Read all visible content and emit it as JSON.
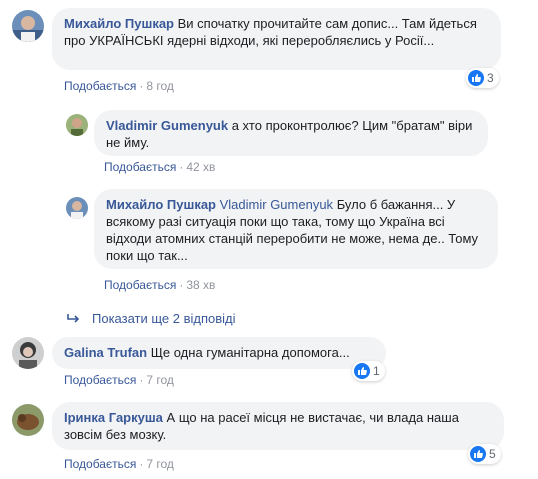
{
  "comments": [
    {
      "author": "Михайло Пушкар",
      "text": "Ви спочатку прочитайте сам допис... Там йдеться про УКРАЇНСЬКІ ядерні відходи, які переробляєлись у Росії...",
      "like_label": "Подобається",
      "time": "8 год",
      "reaction_count": "3"
    },
    {
      "author": "Vladimir Gumenyuk",
      "text": "а хто проконтролює? Цим \"братам\" віри не йму.",
      "like_label": "Подобається",
      "time": "42 хв"
    },
    {
      "author": "Михайло Пушкар",
      "mention": "Vladimir Gumenyuk",
      "text": "Було б бажання... У всякому разі ситуація поки що така, тому що Україна всі відходи атомних станцій переробити не може, нема де.. Тому поки що так...",
      "like_label": "Подобається",
      "time": "38 хв"
    },
    {
      "author": "Galina Trufan",
      "text": "Ще одна гуманітарна допомога...",
      "like_label": "Подобається",
      "time": "7 год",
      "reaction_count": "1"
    },
    {
      "author": "Іринка Гаркуша",
      "text": "А що на расеї місця не вистачає, чи влада наша зовсім без мозку.",
      "like_label": "Подобається",
      "time": "7 год",
      "reaction_count": "5"
    }
  ],
  "more_replies_label": "Показати ще 2 відповіді",
  "separator": "·",
  "icons": {
    "like": "thumbs-up-icon",
    "reply_arrow": "reply-arrow-icon"
  },
  "colors": {
    "link": "#385898",
    "bubble": "#f2f3f5",
    "like_blue": "#1877f2",
    "meta_gray": "#90949c"
  }
}
